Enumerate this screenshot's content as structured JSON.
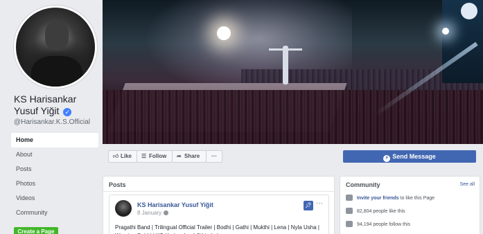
{
  "profile": {
    "name_line1": "KS Harisankar",
    "name_line2": "Yusuf Yiğit",
    "verified_badge": "✓",
    "handle": "@Harisankar.K.S.Official"
  },
  "sidebar": {
    "items": [
      {
        "label": "Home",
        "active": true
      },
      {
        "label": "About"
      },
      {
        "label": "Posts"
      },
      {
        "label": "Photos"
      },
      {
        "label": "Videos"
      },
      {
        "label": "Community"
      }
    ],
    "create_page_label": "Create a Page"
  },
  "actions": {
    "like_label": "Like",
    "follow_label": "Follow",
    "share_label": "Share",
    "more_label": "···",
    "send_message_label": "Send Message"
  },
  "posts": {
    "title": "Posts",
    "post": {
      "author": "KS Harisankar Yusuf Yiğit",
      "date": "8 January",
      "text": "Pragathi Band | Trilingual Official Trailer | Bodhi | Gathi | Mukthi | Lena | Nyla Usha | Wamiqa Gabbi | KS Harisankar | Jithin Lal",
      "more": "···"
    }
  },
  "community": {
    "title": "Community",
    "see_all": "See all",
    "invite_link": "Invite your friends",
    "invite_rest": " to like this Page",
    "likes": "82,804 people like this",
    "follows": "94,194 people follow this"
  },
  "colors": {
    "brand_blue": "#4267b2",
    "link_blue": "#385898",
    "create_green": "#42b72a",
    "page_bg": "#e9ebee"
  }
}
